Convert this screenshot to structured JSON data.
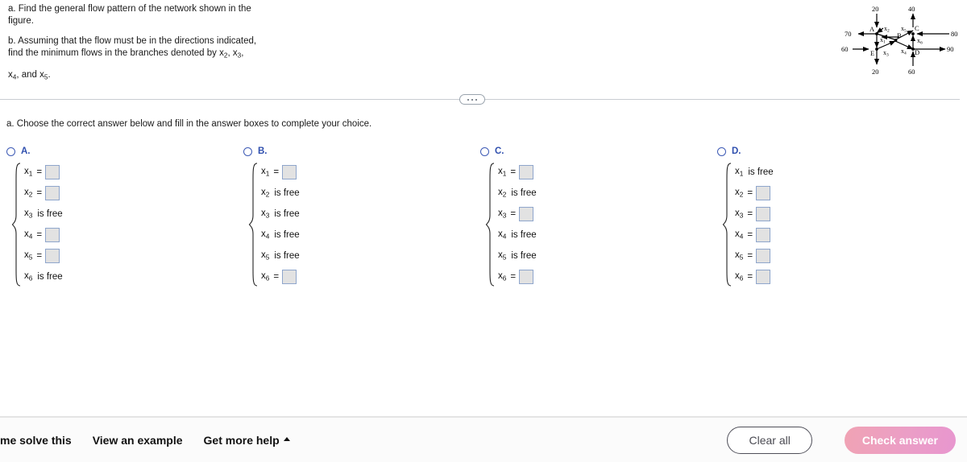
{
  "problem": {
    "part_a": "a. Find the general flow pattern of the network shown in the figure.",
    "part_b_line1": "b. Assuming that the flow must be in the directions indicated,",
    "part_b_line2": "find the minimum flows in the branches denoted by x",
    "part_b_subs": [
      "2",
      "3"
    ],
    "part_b_line3_pre": ", and x",
    "part_b_line3_sub_a": "4",
    "part_b_line3_sub_b": "5",
    "part_b_tail": "."
  },
  "figure": {
    "nodes": [
      "A",
      "B",
      "C",
      "D",
      "E"
    ],
    "branch_labels": [
      "x1",
      "x2",
      "x3",
      "x4",
      "x5",
      "x6"
    ],
    "external_flows": [
      {
        "value": "20",
        "position": "top-left",
        "direction": "in"
      },
      {
        "value": "40",
        "position": "top-right",
        "direction": "out"
      },
      {
        "value": "70",
        "position": "left-upper",
        "direction": "out"
      },
      {
        "value": "60",
        "position": "left-lower",
        "direction": "in"
      },
      {
        "value": "80",
        "position": "right-upper",
        "direction": "in"
      },
      {
        "value": "90",
        "position": "right-lower",
        "direction": "out"
      },
      {
        "value": "20",
        "position": "bottom-left",
        "direction": "out"
      },
      {
        "value": "60",
        "position": "bottom-right",
        "direction": "in"
      }
    ]
  },
  "divider": {
    "dots": [
      "dot",
      "dot",
      "dot"
    ]
  },
  "instruction": "a. Choose the correct answer below and fill in the answer boxes to complete your choice.",
  "options": [
    {
      "letter": "A.",
      "rows": [
        {
          "var": "x",
          "sub": "1",
          "type": "input",
          "value": ""
        },
        {
          "var": "x",
          "sub": "2",
          "type": "input",
          "value": ""
        },
        {
          "var": "x",
          "sub": "3",
          "type": "free",
          "free_text": "is free"
        },
        {
          "var": "x",
          "sub": "4",
          "type": "input",
          "value": ""
        },
        {
          "var": "x",
          "sub": "5",
          "type": "input",
          "value": ""
        },
        {
          "var": "x",
          "sub": "6",
          "type": "free",
          "free_text": "is free"
        }
      ]
    },
    {
      "letter": "B.",
      "rows": [
        {
          "var": "x",
          "sub": "1",
          "type": "input",
          "value": ""
        },
        {
          "var": "x",
          "sub": "2",
          "type": "free",
          "free_text": "is free"
        },
        {
          "var": "x",
          "sub": "3",
          "type": "free",
          "free_text": "is free"
        },
        {
          "var": "x",
          "sub": "4",
          "type": "free",
          "free_text": "is free"
        },
        {
          "var": "x",
          "sub": "5",
          "type": "free",
          "free_text": "is free"
        },
        {
          "var": "x",
          "sub": "6",
          "type": "input",
          "value": ""
        }
      ]
    },
    {
      "letter": "C.",
      "rows": [
        {
          "var": "x",
          "sub": "1",
          "type": "input",
          "value": ""
        },
        {
          "var": "x",
          "sub": "2",
          "type": "free",
          "free_text": "is free"
        },
        {
          "var": "x",
          "sub": "3",
          "type": "input",
          "value": ""
        },
        {
          "var": "x",
          "sub": "4",
          "type": "free",
          "free_text": "is free"
        },
        {
          "var": "x",
          "sub": "5",
          "type": "free",
          "free_text": "is free"
        },
        {
          "var": "x",
          "sub": "6",
          "type": "input",
          "value": ""
        }
      ]
    },
    {
      "letter": "D.",
      "rows": [
        {
          "var": "x",
          "sub": "1",
          "type": "free",
          "free_text": "is free"
        },
        {
          "var": "x",
          "sub": "2",
          "type": "input",
          "value": ""
        },
        {
          "var": "x",
          "sub": "3",
          "type": "input",
          "value": ""
        },
        {
          "var": "x",
          "sub": "4",
          "type": "input",
          "value": ""
        },
        {
          "var": "x",
          "sub": "5",
          "type": "input",
          "value": ""
        },
        {
          "var": "x",
          "sub": "6",
          "type": "input",
          "value": ""
        }
      ]
    }
  ],
  "equals_symbol": "=",
  "bottom_bar": {
    "links": [
      {
        "label": "me solve this",
        "has_caret": false
      },
      {
        "label": "View an example",
        "has_caret": false
      },
      {
        "label": "Get more help",
        "has_caret": true
      }
    ],
    "clear_all_label": "Clear all",
    "check_answer_label": "Check answer"
  },
  "colors": {
    "option_letter": "#2f4fae",
    "radio_border": "#3d5ab5",
    "answer_box_fill": "#e2e2e2",
    "answer_box_border": "#8fa6cc",
    "check_button_start": "#f0a3b4",
    "check_button_end": "#e896cf",
    "divider_line": "#c9ccd1"
  }
}
